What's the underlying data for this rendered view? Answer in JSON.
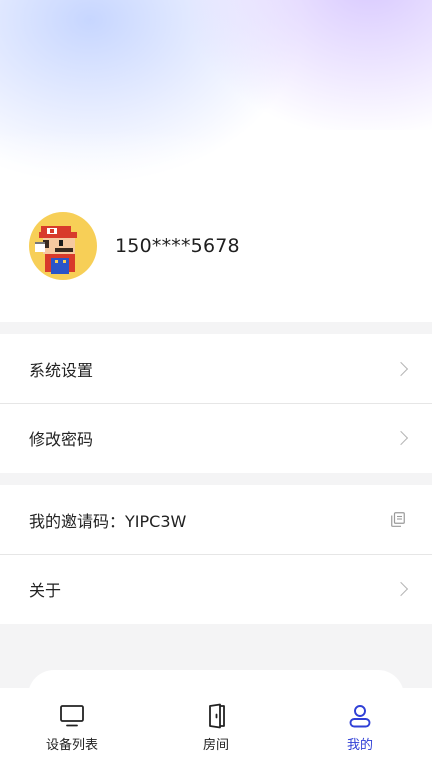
{
  "user": {
    "phone": "150****5678",
    "avatar_icon": "pixel-mario-avatar"
  },
  "menu_group_1": [
    {
      "label": "系统设置",
      "icon": "chevron-right-icon"
    },
    {
      "label": "修改密码",
      "icon": "chevron-right-icon"
    }
  ],
  "menu_group_2": {
    "invite_code_label": "我的邀请码：YIPC3W",
    "invite_copy_icon": "copy-icon",
    "about_label": "关于"
  },
  "tabbar": {
    "items": [
      {
        "label": "设备列表",
        "icon": "monitor-icon",
        "active": false
      },
      {
        "label": "房间",
        "icon": "door-icon",
        "active": false
      },
      {
        "label": "我的",
        "icon": "user-icon",
        "active": true
      }
    ],
    "active_color": "#2f3fd6"
  }
}
